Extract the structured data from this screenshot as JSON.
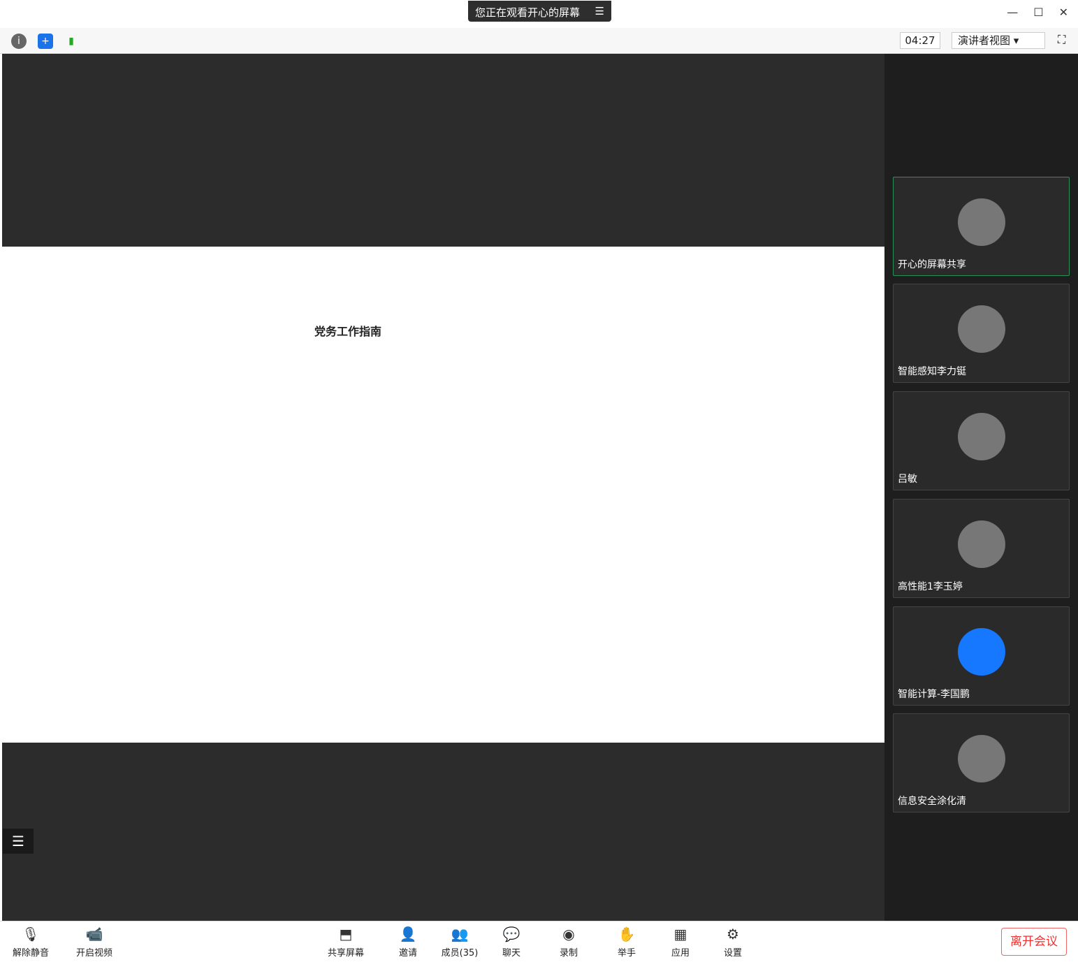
{
  "banner": "您正在观看开心的屏幕",
  "time": "04:27",
  "view": "演讲者视图",
  "participants": [
    {
      "name": "开心的屏幕共享"
    },
    {
      "name": "智能感知李力铤"
    },
    {
      "name": "吕敏"
    },
    {
      "name": "高性能1李玉婷"
    },
    {
      "name": "智能计算-李国鹏"
    },
    {
      "name": "信息安全涂化清"
    }
  ],
  "bottom": {
    "unmute": "解除静音",
    "video": "开启视频",
    "share": "共享屏幕",
    "invite": "邀请",
    "members": "成员(35)",
    "chat": "聊天",
    "record": "录制",
    "hand": "举手",
    "apps": "应用",
    "settings": "设置",
    "leave": "离开会议"
  },
  "doc": {
    "title": "党务工作指南"
  }
}
